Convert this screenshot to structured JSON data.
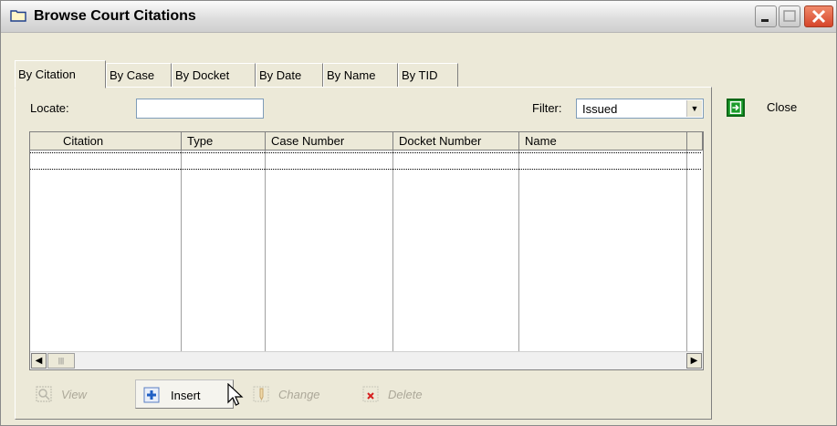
{
  "window": {
    "title": "Browse Court Citations",
    "controls": [
      "minimize",
      "maximize",
      "close"
    ]
  },
  "tabs": [
    {
      "label": "By Citation",
      "active": true
    },
    {
      "label": "By Case",
      "active": false
    },
    {
      "label": "By Docket",
      "active": false
    },
    {
      "label": "By Date",
      "active": false
    },
    {
      "label": "By Name",
      "active": false
    },
    {
      "label": "By TID",
      "active": false
    }
  ],
  "locate": {
    "label": "Locate:",
    "value": ""
  },
  "filter": {
    "label": "Filter:",
    "value": "Issued"
  },
  "grid": {
    "columns": [
      "Citation",
      "Type",
      "Case Number",
      "Docket Number",
      "Name",
      ""
    ]
  },
  "toolbar": {
    "view_label": "View",
    "insert_label": "Insert",
    "change_label": "Change",
    "delete_label": "Delete"
  },
  "side": {
    "close_label": "Close"
  },
  "colors": {
    "window_bg": "#ece9d8",
    "close_icon": "#1a9c2a",
    "insert_icon": "#1f5fc4",
    "delete_icon": "#d62020"
  }
}
